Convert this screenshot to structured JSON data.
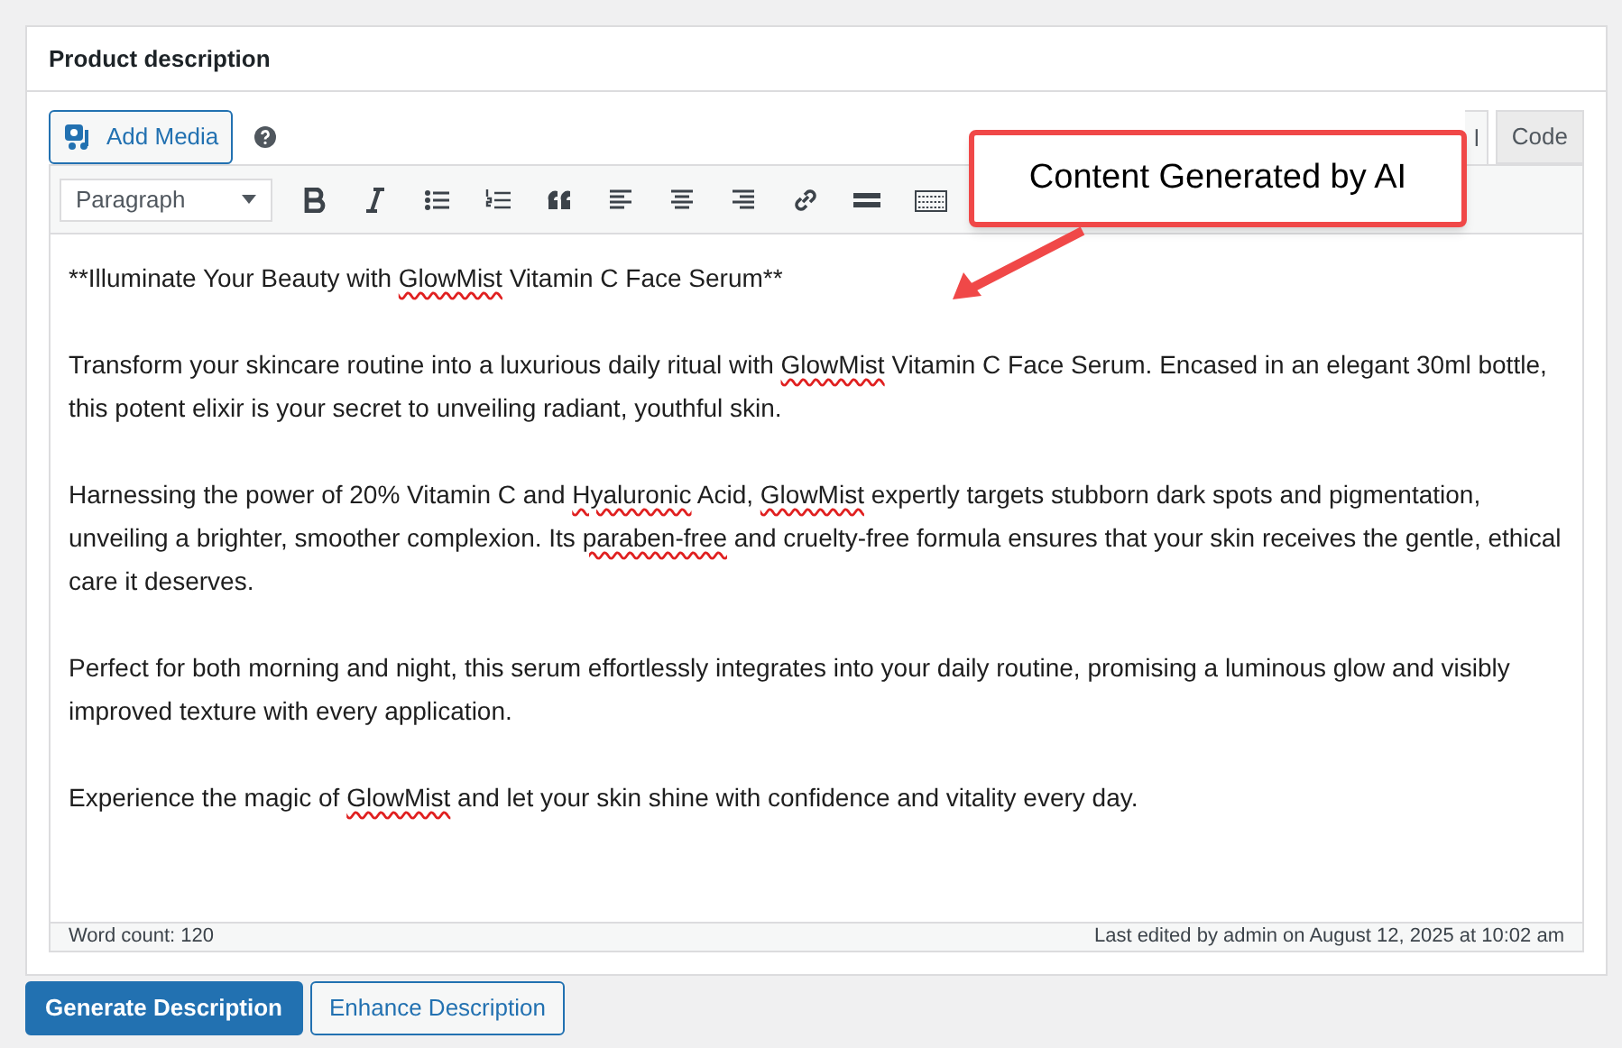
{
  "panel": {
    "title": "Product description"
  },
  "add_media": {
    "label": "Add Media"
  },
  "editor_tabs": [
    {
      "label": "l",
      "selected": true
    },
    {
      "label": "Code",
      "selected": false
    }
  ],
  "toolbar": {
    "format_select": "Paragraph"
  },
  "content": [
    {
      "segments": [
        {
          "text": "**Illuminate Your Beauty with ",
          "misspelled": false
        },
        {
          "text": "GlowMist",
          "misspelled": true
        },
        {
          "text": " Vitamin C Face Serum**",
          "misspelled": false
        }
      ]
    },
    {
      "segments": [
        {
          "text": "Transform your skincare routine into a luxurious daily ritual with ",
          "misspelled": false
        },
        {
          "text": "GlowMist",
          "misspelled": true
        },
        {
          "text": " Vitamin C Face Serum. Encased in an elegant 30ml bottle, this potent elixir is your secret to unveiling radiant, youthful skin.",
          "misspelled": false
        }
      ]
    },
    {
      "segments": [
        {
          "text": "Harnessing the power of 20% Vitamin C and ",
          "misspelled": false
        },
        {
          "text": "Hyaluronic",
          "misspelled": true
        },
        {
          "text": " Acid, ",
          "misspelled": false
        },
        {
          "text": "GlowMist",
          "misspelled": true
        },
        {
          "text": " expertly targets stubborn dark spots and pigmentation, unveiling a brighter, smoother complexion. Its ",
          "misspelled": false
        },
        {
          "text": "paraben-free",
          "misspelled": true
        },
        {
          "text": " and cruelty-free formula ensures that your skin receives the gentle, ethical care it deserves.",
          "misspelled": false
        }
      ]
    },
    {
      "segments": [
        {
          "text": "Perfect for both morning and night, this serum effortlessly integrates into your daily routine, promising a luminous glow and visibly improved texture with every application.",
          "misspelled": false
        }
      ]
    },
    {
      "segments": [
        {
          "text": "Experience the magic of ",
          "misspelled": false
        },
        {
          "text": "GlowMist",
          "misspelled": true
        },
        {
          "text": " and let your skin shine with confidence and vitality every day.",
          "misspelled": false
        }
      ]
    }
  ],
  "status_bar": {
    "word_count": "Word count: 120",
    "last_edited": "Last edited by admin on August 12, 2025 at 10:02 am"
  },
  "callout": {
    "text": "Content Generated by AI"
  },
  "buttons": [
    {
      "label": "Generate Description",
      "kind": "primary"
    },
    {
      "label": "Enhance Description",
      "kind": "secondary"
    }
  ]
}
